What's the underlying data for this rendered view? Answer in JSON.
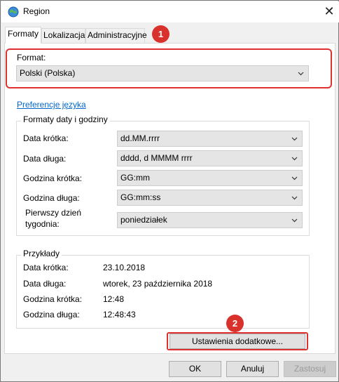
{
  "window": {
    "title": "Region",
    "close_glyph": "✕"
  },
  "tabs": [
    {
      "label": "Formaty"
    },
    {
      "label": "Lokalizacja"
    },
    {
      "label": "Administracyjne"
    }
  ],
  "badges": [
    "1",
    "2"
  ],
  "format": {
    "label": "Format:",
    "value": "Polski (Polska)"
  },
  "language_link": "Preferencje języka",
  "datetime_group": {
    "title": "Formaty daty i godziny",
    "rows": [
      {
        "label": "Data krótka:",
        "value": "dd.MM.rrrr"
      },
      {
        "label": "Data długa:",
        "value": "dddd, d MMMM rrrr"
      },
      {
        "label": "Godzina krótka:",
        "value": "GG:mm"
      },
      {
        "label": "Godzina długa:",
        "value": "GG:mm:ss"
      },
      {
        "label_line1": "Pierwszy dzień",
        "label_line2": "tygodnia:",
        "value": "poniedziałek"
      }
    ]
  },
  "examples_group": {
    "title": "Przykłady",
    "rows": [
      {
        "label": "Data krótka:",
        "value": "23.10.2018"
      },
      {
        "label": "Data długa:",
        "value": "wtorek, 23 października 2018"
      },
      {
        "label": "Godzina krótka:",
        "value": "12:48"
      },
      {
        "label": "Godzina długa:",
        "value": "12:48:43"
      }
    ]
  },
  "additional_settings_button": "Ustawienia dodatkowe...",
  "footer": {
    "ok": "OK",
    "cancel": "Anuluj",
    "apply": "Zastosuj"
  },
  "colors": {
    "accent_red": "#d9312b",
    "link_blue": "#0066cc"
  }
}
